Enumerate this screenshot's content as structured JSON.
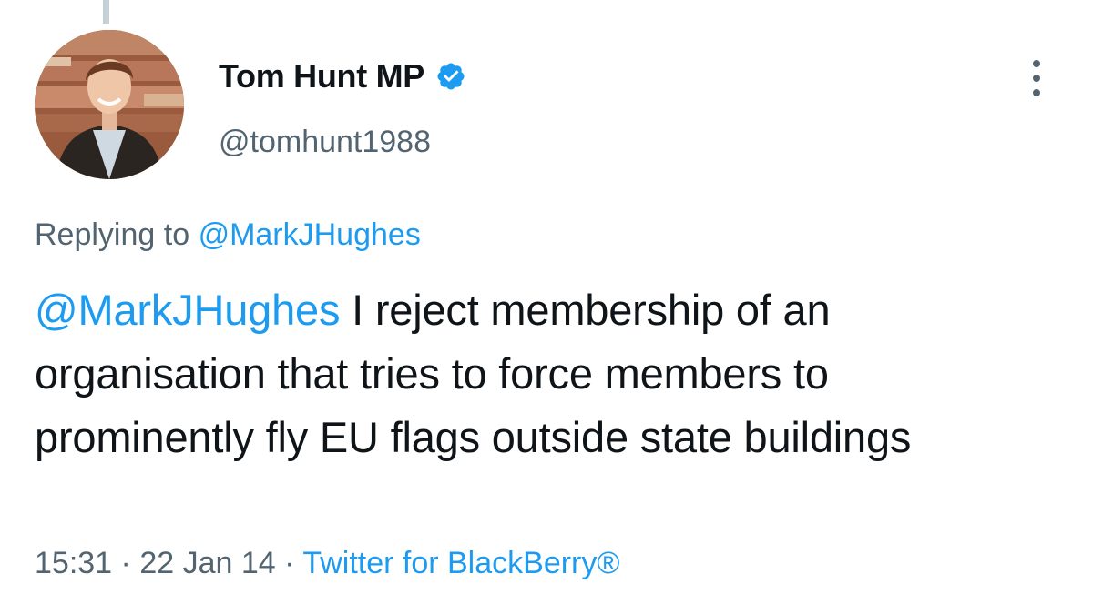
{
  "author": {
    "display_name": "Tom Hunt MP",
    "handle": "@tomhunt1988",
    "verified": true
  },
  "reply": {
    "prefix": "Replying to",
    "mention": "@MarkJHughes"
  },
  "tweet": {
    "mention": "@MarkJHughes",
    "text": " I reject membership of an organisation that tries to force members to prominently fly EU flags outside state buildings"
  },
  "meta": {
    "time": "15:31",
    "separator": "·",
    "date": "22 Jan 14",
    "source": "Twitter for BlackBerry®"
  },
  "icons": {
    "verified": "verified-badge-icon",
    "more": "more-vertical-icon"
  },
  "colors": {
    "link": "#1d9bf0",
    "secondary_text": "#536471",
    "primary_text": "#0f1419",
    "thread_line": "#c4cfd6"
  }
}
